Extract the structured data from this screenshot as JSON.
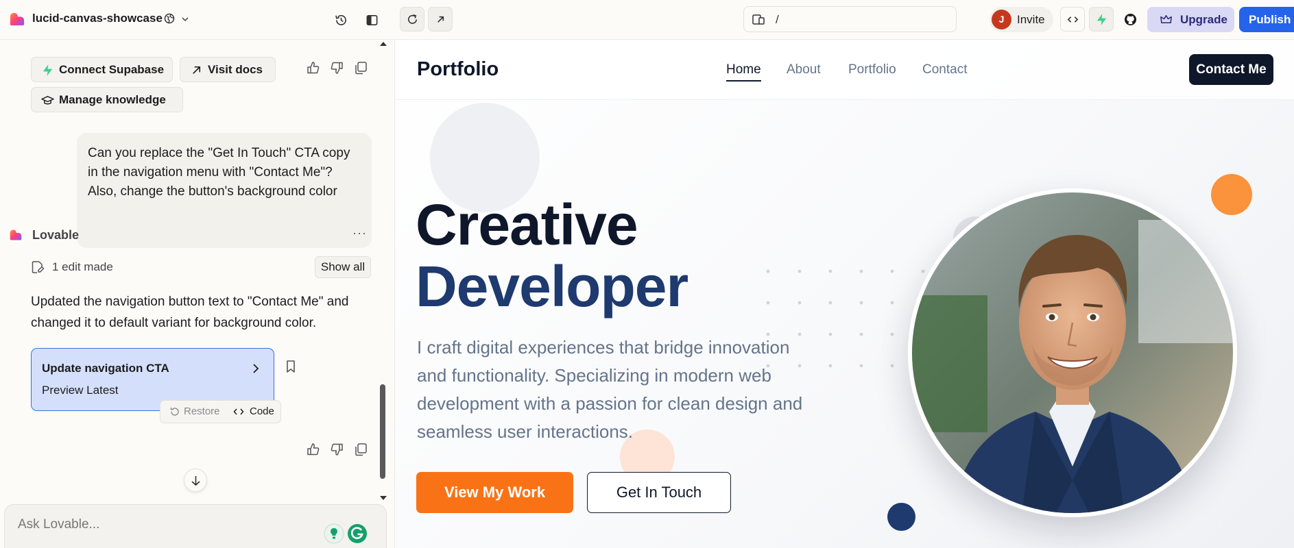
{
  "topbar": {
    "project_name": "lucid-canvas-showcase",
    "url_path": "/",
    "invite_avatar": "J",
    "invite_label": "Invite",
    "upgrade_label": "Upgrade",
    "publish_label": "Publish"
  },
  "chat": {
    "chips": {
      "supabase": "Connect Supabase",
      "docs": "Visit docs",
      "knowledge": "Manage knowledge"
    },
    "user_message": "Can you replace the \"Get In Touch\" CTA copy in the navigation menu with \"Contact Me\"? Also, change the button's background color",
    "assistant_name": "Lovable",
    "edit_count": "1 edit made",
    "show_all": "Show all",
    "assistant_message": "Updated the navigation button text to \"Contact Me\" and changed it to default variant for background color.",
    "version_card": {
      "title": "Update navigation CTA",
      "subtitle": "Preview Latest"
    },
    "restore_label": "Restore",
    "code_label": "Code",
    "input_placeholder": "Ask Lovable..."
  },
  "preview": {
    "logo": "Portfolio",
    "nav": [
      "Home",
      "About",
      "Portfolio",
      "Contact"
    ],
    "nav_cta": "Contact Me",
    "hero_line1": "Creative",
    "hero_line2": "Developer",
    "hero_paragraph": "I craft digital experiences that bridge innovation and functionality. Specializing in modern web development with a passion for clean design and seamless user interactions.",
    "primary_button": "View My Work",
    "secondary_button": "Get In Touch"
  },
  "colors": {
    "accent_blue": "#2563eb",
    "orange": "#f97316",
    "navy": "#0f172a",
    "version_card_bg": "#d4e0fb"
  },
  "icons": [
    "lovable-logo-icon",
    "globe-icon",
    "chevron-down-icon",
    "history-icon",
    "sidebar-icon",
    "refresh-icon",
    "open-external-icon",
    "device-icon",
    "code-icon",
    "supabase-icon",
    "github-icon",
    "crown-icon",
    "thumbs-up-icon",
    "thumbs-down-icon",
    "copy-icon",
    "arrow-up-right-icon",
    "graduation-cap-icon",
    "edit-file-icon",
    "chevron-right-icon",
    "bookmark-icon",
    "restore-icon",
    "arrow-down-icon"
  ]
}
